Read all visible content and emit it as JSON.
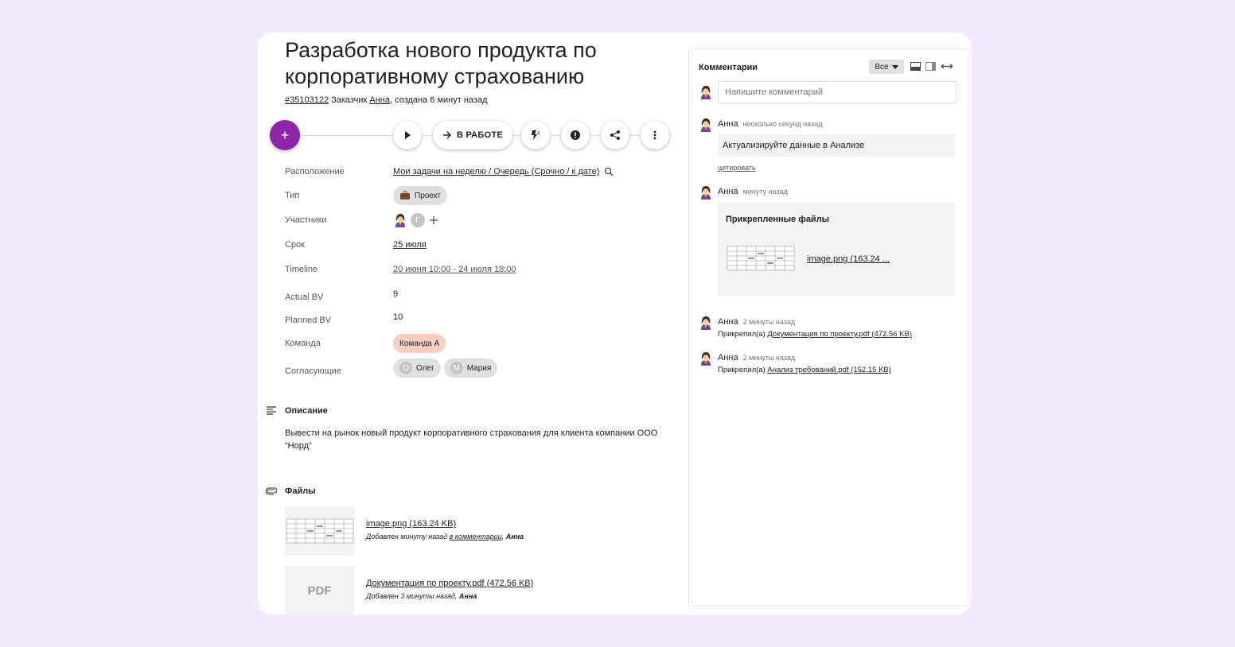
{
  "task": {
    "title": "Разработка нового продукта по корпоративному страхованию",
    "id": "#35103122",
    "customer_prefix": " Заказчик ",
    "customer": "Анна",
    "created": ", создана 6 минут назад"
  },
  "toolbar": {
    "add_label": "+",
    "status_label": "В РАБОТЕ"
  },
  "properties": {
    "location_label": "Расположение",
    "location_value": "Мои задачи на неделю / Очередь (Срочно / к дате)",
    "type_label": "Тип",
    "type_value": "Проект",
    "members_label": "Участники",
    "member_letter": "Г",
    "deadline_label": "Срок",
    "deadline_value": "25 июля",
    "timeline_label": "Timeline",
    "timeline_value": "20 июня 10:00 - 24 июля 18:00",
    "actual_bv_label": "Actual BV",
    "actual_bv_value": "9",
    "planned_bv_label": "Planned BV",
    "planned_bv_value": "10",
    "team_label": "Команда",
    "team_value": "Команда А",
    "approvers_label": "Согласующие",
    "approvers": [
      {
        "letter": "О",
        "name": "Олег"
      },
      {
        "letter": "М",
        "name": "Мария"
      }
    ]
  },
  "description": {
    "heading": "Описание",
    "text": "Вывести на рынок новый продукт корпоративного страхования для клиента компании ООО “Норд”"
  },
  "files": {
    "heading": "Файлы",
    "items": [
      {
        "name": "image.png (163.24 KB)",
        "info_prefix": "Добавлен минуту назад ",
        "info_link": "в комментарии",
        "info_sep": ", ",
        "author": "Анна"
      },
      {
        "thumb": "PDF",
        "name": "Документация по проекту.pdf (472.56 KB)",
        "info_prefix": "Добавлен 3 минуты назад, ",
        "author": "Анна"
      }
    ]
  },
  "comments": {
    "heading": "Комментарии",
    "filter": "Все",
    "placeholder": "Напишите комментарий",
    "items": [
      {
        "author": "Анна",
        "time": "несколько секунд назад",
        "text": "Актуализируйте данные в Анализе",
        "quote": "цитировать"
      },
      {
        "author": "Анна",
        "time": "минуту назад",
        "attached_heading": "Прикрепленные файлы",
        "file": "image.png (163.24 ..."
      },
      {
        "author": "Анна",
        "time": "2 минуты назад",
        "prefix": "Прикрепил(а) ",
        "file": "Документация по проекту.pdf (472.56 KB)"
      },
      {
        "author": "Анна",
        "time": "2 минуты назад",
        "prefix": "Прикрепил(а) ",
        "file": "Анализ требований.pdf (152.15 KB)"
      }
    ]
  },
  "colors": {
    "background": "#f3eafc",
    "accent": "#8e24aa",
    "team_chip": "#f8cfc0"
  }
}
